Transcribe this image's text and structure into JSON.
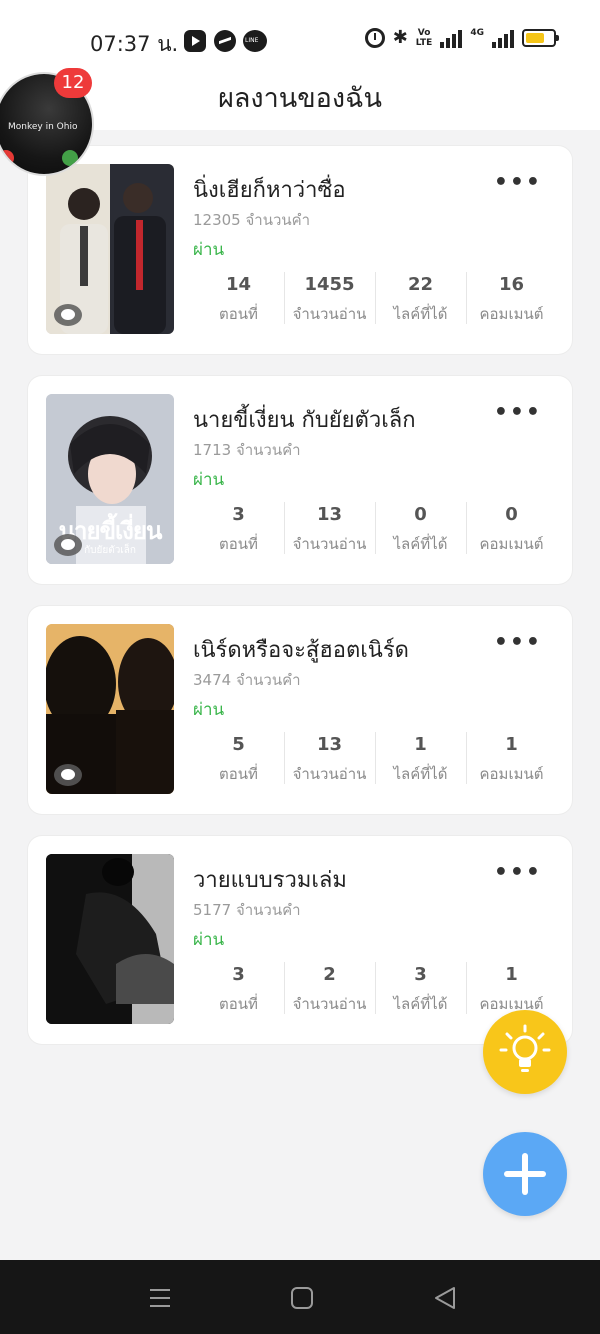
{
  "status_bar": {
    "time": "07:37 น.",
    "apps": [
      "youtube-icon",
      "messenger-icon",
      "line-icon"
    ],
    "volte": "VoLTE",
    "network": "4G",
    "battery_level": 0.7,
    "battery_color": "#f5c518"
  },
  "header": {
    "title": "ผลงานของฉัน"
  },
  "floating_video": {
    "caption": "Monkey in Ohio",
    "notification_count": "12"
  },
  "works": [
    {
      "title": "นิ่งเฮียก็หาว่าซื่อ",
      "word_count": "12305 จำนวนคำ",
      "status": "ผ่าน",
      "stats": [
        {
          "value": "14",
          "label": "ตอนที่"
        },
        {
          "value": "1455",
          "label": "จำนวนอ่าน"
        },
        {
          "value": "22",
          "label": "ไลค์ที่ได้"
        },
        {
          "value": "16",
          "label": "คอมเมนต์"
        }
      ]
    },
    {
      "title": "นายขี้เงี่ยน กับยัยตัวเล็ก",
      "word_count": "1713 จำนวนคำ",
      "status": "ผ่าน",
      "cover_text": "นายขี้เงี่ยน",
      "cover_sub": "กับยัยตัวเล็ก",
      "stats": [
        {
          "value": "3",
          "label": "ตอนที่"
        },
        {
          "value": "13",
          "label": "จำนวนอ่าน"
        },
        {
          "value": "0",
          "label": "ไลค์ที่ได้"
        },
        {
          "value": "0",
          "label": "คอมเมนต์"
        }
      ]
    },
    {
      "title": "เนิร์ดหรือจะสู้ฮอตเนิร์ด",
      "word_count": "3474 จำนวนคำ",
      "status": "ผ่าน",
      "stats": [
        {
          "value": "5",
          "label": "ตอนที่"
        },
        {
          "value": "13",
          "label": "จำนวนอ่าน"
        },
        {
          "value": "1",
          "label": "ไลค์ที่ได้"
        },
        {
          "value": "1",
          "label": "คอมเมนต์"
        }
      ]
    },
    {
      "title": "วายแบบรวมเล่ม",
      "word_count": "5177 จำนวนคำ",
      "status": "ผ่าน",
      "stats": [
        {
          "value": "3",
          "label": "ตอนที่"
        },
        {
          "value": "2",
          "label": "จำนวนอ่าน"
        },
        {
          "value": "3",
          "label": "ไลค์ที่ได้"
        },
        {
          "value": "1",
          "label": "คอมเมนต์"
        }
      ]
    }
  ],
  "colors": {
    "approved": "#39b54a",
    "fab_bulb": "#f8c61a",
    "fab_add": "#5ba8f5"
  },
  "more_menu_glyph": "•••"
}
